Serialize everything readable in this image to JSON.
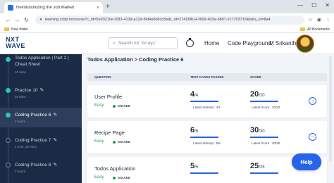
{
  "browser": {
    "tab_title": "Revolutionizing the Job Market",
    "tab_close": "×",
    "new_tab": "+",
    "url": "learning.ccbp.in/course?c_id=5e93210e-f183-413d-a12d-f9d4e0b8cd3e&t_id=2741f0b14-f669-403a-b897-2c7703715&tabs_id=8a4",
    "bookmark_new_folder": "New folder",
    "bookmark_all": "All Bookmarks"
  },
  "header": {
    "logo_line1": "NXT",
    "logo_line2": "WAVE",
    "search_placeholder": "Search for 'Arrays'",
    "nav_home": "Home",
    "nav_playground": "Code Playground",
    "user_name": "M Srikanth"
  },
  "sidebar": {
    "items": [
      {
        "title": "Todos Application | Part 2 |",
        "title2": "Cheat Sheet",
        "meta": "10 mins",
        "done": true
      },
      {
        "title": "Practice 10",
        "meta": "25 mins",
        "done": true
      },
      {
        "title": "Coding Practice 6",
        "meta": "2 hours",
        "done": true,
        "active": true
      },
      {
        "title": "Coding Practice 7",
        "meta": "1 hour, 30 mins",
        "done": false
      },
      {
        "title": "Coding Practice 8",
        "meta": "2 hours",
        "done": false
      }
    ]
  },
  "main": {
    "breadcrumb": "Todos Application > Coding Practice 6",
    "col_question": "QUESTION",
    "col_tests": "TEST CASES PASSED",
    "col_score": "SCORE",
    "rows": [
      {
        "title": "User Profile",
        "difficulty": "Easy",
        "status": "SOLVED",
        "tests_passed": "4",
        "tests_total": "/4",
        "tests_fraction": 1.0,
        "latest_attempt": "Latest Attempt : 4/4",
        "score": "20",
        "score_total": "/20",
        "score_fraction": 1.0,
        "latest_score": "Latest Score : 20/20"
      },
      {
        "title": "Recipe Page",
        "difficulty": "Easy",
        "status": "SOLVED",
        "tests_passed": "6",
        "tests_total": "/6",
        "tests_fraction": 1.0,
        "latest_attempt": "Latest Attempt : 6/6",
        "score": "30",
        "score_total": "/30",
        "score_fraction": 1.0,
        "latest_score": "Latest Score : 30/30"
      },
      {
        "title": "Todos Application",
        "difficulty": "Easy",
        "status": "SOLVED",
        "tests_passed": "5",
        "tests_total": "/5",
        "tests_fraction": 1.0,
        "latest_attempt": "",
        "score": "25",
        "score_total": "/25",
        "score_fraction": 1.0,
        "latest_score": ""
      }
    ],
    "help_label": "Help"
  },
  "colors": {
    "accent": "#2563eb",
    "sidebar_bg": "#1b2b45",
    "success": "#16a34a"
  },
  "icons": [
    "search-icon",
    "timer-icon",
    "edit-icon",
    "arrow-right-circle-icon",
    "lock-icon",
    "back-icon",
    "forward-icon",
    "reload-icon"
  ]
}
